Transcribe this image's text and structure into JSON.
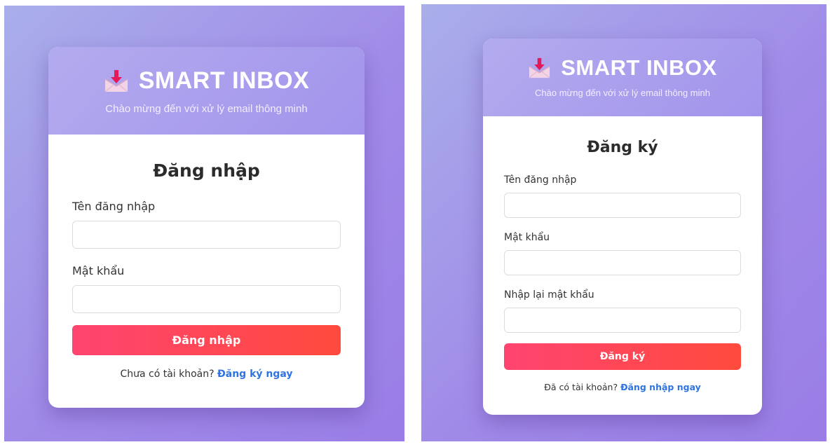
{
  "colors": {
    "background_gradient": [
      "#a9aeea",
      "#9a7de6"
    ],
    "header_gradient": [
      "#b3abee",
      "#a294ec"
    ],
    "button_gradient": [
      "#ff4470",
      "#ff4a3d"
    ],
    "link": "#2f74e0"
  },
  "brand": {
    "icon": "inbox-tray-icon",
    "title": "SMART INBOX",
    "subtitle": "Chào mừng đến với xử lý email thông minh"
  },
  "login": {
    "heading": "Đăng nhập",
    "username_label": "Tên đăng nhập",
    "username_value": "",
    "password_label": "Mật khẩu",
    "password_value": "",
    "submit_label": "Đăng nhập",
    "footer_text": "Chưa có tài khoản?",
    "footer_link": "Đăng ký ngay"
  },
  "register": {
    "heading": "Đăng ký",
    "username_label": "Tên đăng nhập",
    "username_value": "",
    "password_label": "Mật khẩu",
    "password_value": "",
    "confirm_label": "Nhập lại mật khẩu",
    "confirm_value": "",
    "submit_label": "Đăng ký",
    "footer_text": "Đã có tài khoản?",
    "footer_link": "Đăng nhập ngay"
  }
}
